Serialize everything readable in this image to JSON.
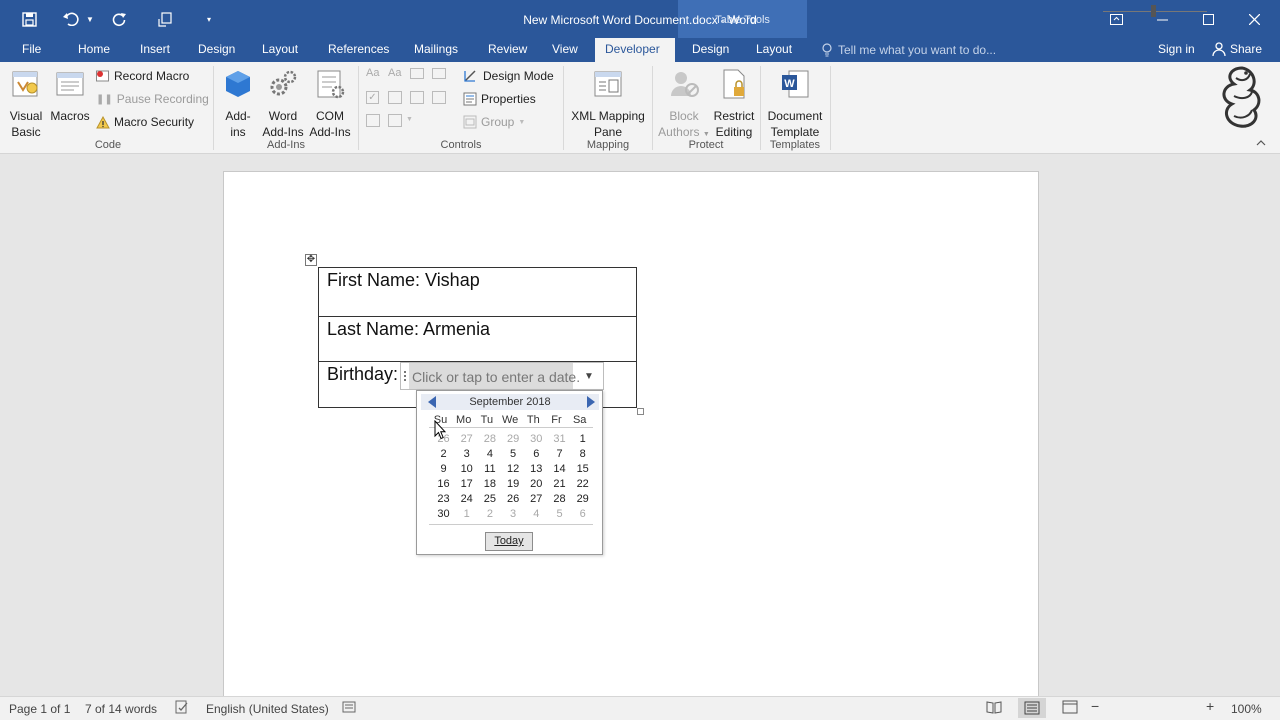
{
  "titlebar": {
    "document_title": "New Microsoft Word Document.docx - Word",
    "contextual_group": "Table Tools",
    "qat": [
      "save-icon",
      "undo-icon",
      "undo-dropdown-icon",
      "redo-icon",
      "touch-mode-icon",
      "customize-qat-icon"
    ]
  },
  "tabs": {
    "file": "File",
    "home": "Home",
    "insert": "Insert",
    "design": "Design",
    "layout": "Layout",
    "references": "References",
    "mailings": "Mailings",
    "review": "Review",
    "view": "View",
    "developer": "Developer",
    "table_design": "Design",
    "table_layout": "Layout",
    "tell_me_placeholder": "Tell me what you want to do...",
    "sign_in": "Sign in",
    "share": "Share"
  },
  "ribbon": {
    "code": {
      "label": "Code",
      "visual_basic_1": "Visual",
      "visual_basic_2": "Basic",
      "macros": "Macros",
      "record_macro": "Record Macro",
      "pause_recording": "Pause Recording",
      "macro_security": "Macro Security"
    },
    "addins": {
      "label": "Add-Ins",
      "addins_1": "Add-",
      "addins_2": "ins",
      "word_addins_1": "Word",
      "word_addins_2": "Add-Ins",
      "com_addins_1": "COM",
      "com_addins_2": "Add-Ins"
    },
    "controls": {
      "label": "Controls",
      "design_mode": "Design Mode",
      "properties": "Properties",
      "group": "Group"
    },
    "mapping": {
      "label": "Mapping",
      "xml_1": "XML Mapping",
      "xml_2": "Pane"
    },
    "protect": {
      "label": "Protect",
      "block_1": "Block",
      "block_2": "Authors",
      "restrict_1": "Restrict",
      "restrict_2": "Editing"
    },
    "templates": {
      "label": "Templates",
      "doc_1": "Document",
      "doc_2": "Template"
    }
  },
  "document": {
    "first_name": "First Name: Vishap",
    "last_name": "Last Name: Armenia",
    "birthday_label": "Birthday:",
    "date_placeholder": "Click or tap to enter a date."
  },
  "calendar": {
    "month": "September 2018",
    "days": [
      "Su",
      "Mo",
      "Tu",
      "We",
      "Th",
      "Fr",
      "Sa"
    ],
    "weeks": [
      [
        {
          "d": "26",
          "o": true
        },
        {
          "d": "27",
          "o": true
        },
        {
          "d": "28",
          "o": true
        },
        {
          "d": "29",
          "o": true
        },
        {
          "d": "30",
          "o": true
        },
        {
          "d": "31",
          "o": true
        },
        {
          "d": "1",
          "o": false
        }
      ],
      [
        {
          "d": "2",
          "o": false
        },
        {
          "d": "3",
          "o": false
        },
        {
          "d": "4",
          "o": false
        },
        {
          "d": "5",
          "o": false
        },
        {
          "d": "6",
          "o": false
        },
        {
          "d": "7",
          "o": false
        },
        {
          "d": "8",
          "o": false
        }
      ],
      [
        {
          "d": "9",
          "o": false
        },
        {
          "d": "10",
          "o": false
        },
        {
          "d": "11",
          "o": false
        },
        {
          "d": "12",
          "o": false
        },
        {
          "d": "13",
          "o": false
        },
        {
          "d": "14",
          "o": false
        },
        {
          "d": "15",
          "o": false
        }
      ],
      [
        {
          "d": "16",
          "o": false
        },
        {
          "d": "17",
          "o": false
        },
        {
          "d": "18",
          "o": false
        },
        {
          "d": "19",
          "o": false
        },
        {
          "d": "20",
          "o": false
        },
        {
          "d": "21",
          "o": false
        },
        {
          "d": "22",
          "o": false
        }
      ],
      [
        {
          "d": "23",
          "o": false
        },
        {
          "d": "24",
          "o": false
        },
        {
          "d": "25",
          "o": false
        },
        {
          "d": "26",
          "o": false
        },
        {
          "d": "27",
          "o": false
        },
        {
          "d": "28",
          "o": false
        },
        {
          "d": "29",
          "o": false
        }
      ],
      [
        {
          "d": "30",
          "o": false
        },
        {
          "d": "1",
          "o": true
        },
        {
          "d": "2",
          "o": true
        },
        {
          "d": "3",
          "o": true
        },
        {
          "d": "4",
          "o": true
        },
        {
          "d": "5",
          "o": true
        },
        {
          "d": "6",
          "o": true
        }
      ]
    ],
    "today": "Today"
  },
  "statusbar": {
    "page": "Page 1 of 1",
    "words": "7 of 14 words",
    "language": "English (United States)",
    "zoom": "100%"
  },
  "colors": {
    "title_blue": "#2b579a",
    "contextual_blue": "#3f6fb6",
    "ribbon_bg": "#f3f3f3"
  }
}
